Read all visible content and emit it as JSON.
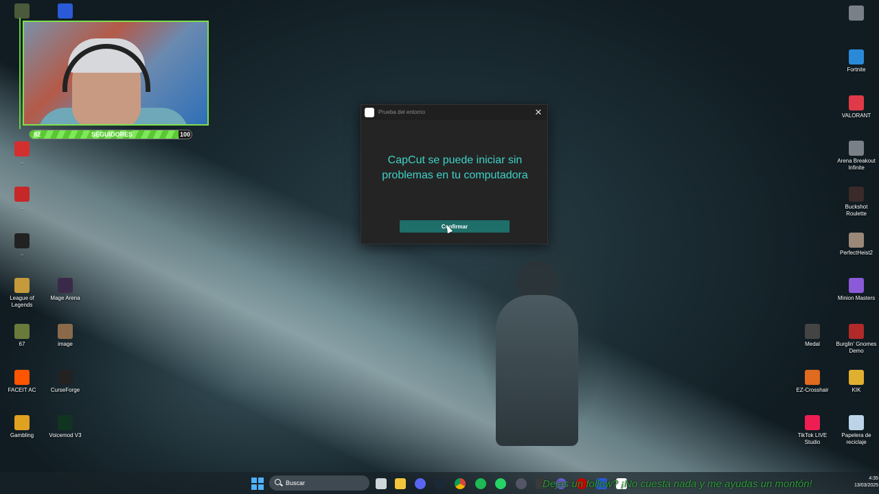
{
  "dialog": {
    "title": "Prueba del entorno",
    "message": "CapCut se puede iniciar sin problemas en tu computadora",
    "confirm_label": "Confirmar",
    "close_symbol": "✕",
    "accent": "#3fd2c7"
  },
  "webcam": {
    "follow_bar": {
      "current": "92",
      "label": "SEGUIDORES",
      "goal": "100",
      "progress": 0.92
    }
  },
  "desktop_left": [
    {
      "label": "..",
      "color": "#d32f2f"
    },
    {
      "label": "..",
      "color": "#c62828"
    },
    {
      "label": "..",
      "color": "#222222"
    },
    {
      "label": "League of Legends",
      "color": "#c49a3a"
    },
    {
      "label": "Mage Arena",
      "color": "#3a2a4a"
    },
    {
      "label": "67",
      "color": "#6a7a3a"
    },
    {
      "label": "image",
      "color": "#8a6a4a"
    },
    {
      "label": "FACEIT AC",
      "color": "#ff5500"
    },
    {
      "label": "CurseForge",
      "color": "#222222"
    },
    {
      "label": "Gambling",
      "color": "#e0a020"
    },
    {
      "label": "Voicemod V3",
      "color": "#113322"
    }
  ],
  "desktop_right": [
    {
      "label": "Fortnite",
      "color": "#2a8ad8"
    },
    {
      "label": "VALORANT",
      "color": "#e03a48"
    },
    {
      "label": "Arena Breakout Infinite",
      "color": "#7a8088"
    },
    {
      "label": "Buckshot Roulette",
      "color": "#3a2a2a"
    },
    {
      "label": "PerfectHeist2",
      "color": "#9a8878"
    },
    {
      "label": "Minion Masters",
      "color": "#8a5ad8"
    },
    {
      "label": "Medal",
      "color": "#444444"
    },
    {
      "label": "Burglin' Gnomes Demo",
      "color": "#b02a2a"
    },
    {
      "label": "EZ-Crosshair",
      "color": "#e06a20"
    },
    {
      "label": "KIK",
      "color": "#e0b030"
    },
    {
      "label": "TikTok LIVE Studio",
      "color": "#ee1d52"
    },
    {
      "label": "Papelera de reciclaje",
      "color": "#bcd4e8"
    }
  ],
  "taskbar": {
    "search_placeholder": "Buscar",
    "ticker": "Dejas un follow? ¡No cuesta nada y me ayudas un montón!",
    "time": "4:35",
    "date": "13/03/2025"
  }
}
